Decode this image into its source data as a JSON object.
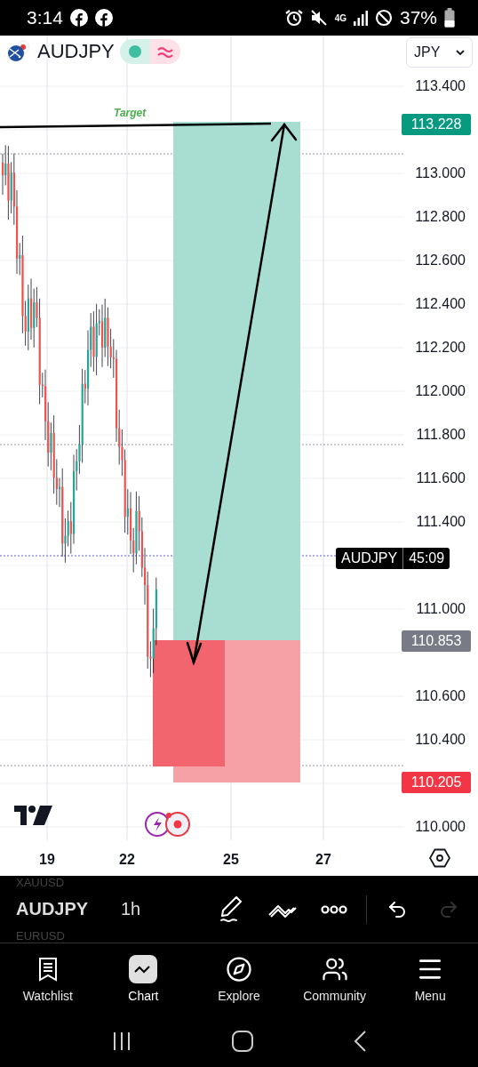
{
  "status_bar": {
    "time": "3:14",
    "network": "4G",
    "battery": "37%"
  },
  "header": {
    "symbol": "AUDJPY",
    "currency": "JPY"
  },
  "chart": {
    "price_labels": [
      "113.400",
      "113.000",
      "112.800",
      "112.600",
      "112.400",
      "112.200",
      "112.000",
      "111.800",
      "111.600",
      "111.400",
      "111.000",
      "110.600",
      "110.400",
      "110.000"
    ],
    "time_labels": [
      "19",
      "22",
      "25",
      "27"
    ],
    "target_label": "Target",
    "take_profit_tag": "113.228",
    "countdown": {
      "symbol": "AUDJPY",
      "time": "45:09"
    },
    "entry_tag": "110.853",
    "stop_tag": "110.205"
  },
  "toolbar": {
    "previous_symbol": "XAUUSD",
    "symbol": "AUDJPY",
    "interval": "1h",
    "next_symbol": "EURUSD"
  },
  "nav": [
    {
      "label": "Watchlist",
      "kind": "watchlist",
      "selected": false
    },
    {
      "label": "Chart",
      "kind": "chart",
      "selected": true
    },
    {
      "label": "Explore",
      "kind": "explore",
      "selected": false
    },
    {
      "label": "Community",
      "kind": "community",
      "selected": false
    },
    {
      "label": "Menu",
      "kind": "menu",
      "selected": false
    }
  ]
}
